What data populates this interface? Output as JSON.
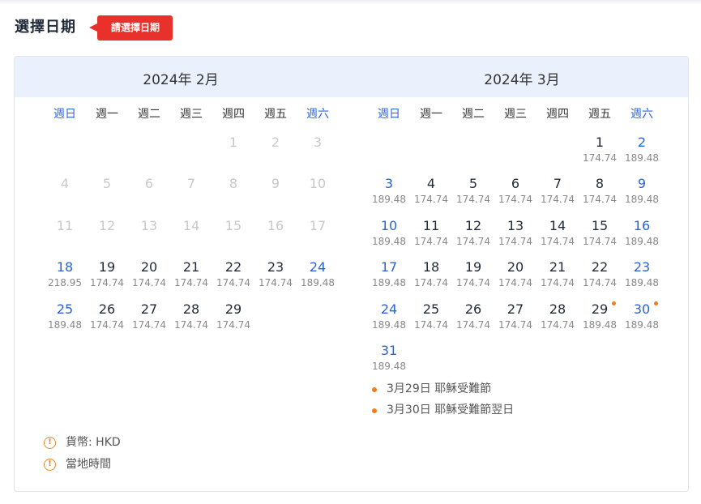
{
  "header": {
    "title": "選擇日期",
    "hint": "請選擇日期"
  },
  "weekdays": [
    "週日",
    "週一",
    "週二",
    "週三",
    "週四",
    "週五",
    "週六"
  ],
  "months": [
    {
      "title": "2024年 2月",
      "days": [
        {
          "d": "1",
          "p": "",
          "dis": true
        },
        {
          "d": "2",
          "p": "",
          "dis": true
        },
        {
          "d": "3",
          "p": "",
          "dis": true
        },
        {
          "d": "4",
          "p": "",
          "dis": true
        },
        {
          "d": "5",
          "p": "",
          "dis": true
        },
        {
          "d": "6",
          "p": "",
          "dis": true
        },
        {
          "d": "7",
          "p": "",
          "dis": true
        },
        {
          "d": "8",
          "p": "",
          "dis": true
        },
        {
          "d": "9",
          "p": "",
          "dis": true
        },
        {
          "d": "10",
          "p": "",
          "dis": true
        },
        {
          "d": "11",
          "p": "",
          "dis": true
        },
        {
          "d": "12",
          "p": "",
          "dis": true
        },
        {
          "d": "13",
          "p": "",
          "dis": true
        },
        {
          "d": "14",
          "p": "",
          "dis": true
        },
        {
          "d": "15",
          "p": "",
          "dis": true
        },
        {
          "d": "16",
          "p": "",
          "dis": true
        },
        {
          "d": "17",
          "p": "",
          "dis": true
        },
        {
          "d": "18",
          "p": "218.95"
        },
        {
          "d": "19",
          "p": "174.74"
        },
        {
          "d": "20",
          "p": "174.74"
        },
        {
          "d": "21",
          "p": "174.74"
        },
        {
          "d": "22",
          "p": "174.74"
        },
        {
          "d": "23",
          "p": "174.74"
        },
        {
          "d": "24",
          "p": "189.48"
        },
        {
          "d": "25",
          "p": "189.48"
        },
        {
          "d": "26",
          "p": "174.74"
        },
        {
          "d": "27",
          "p": "174.74"
        },
        {
          "d": "28",
          "p": "174.74"
        },
        {
          "d": "29",
          "p": "174.74"
        }
      ]
    },
    {
      "title": "2024年 3月",
      "days": [
        {
          "d": "1",
          "p": "174.74"
        },
        {
          "d": "2",
          "p": "189.48"
        },
        {
          "d": "3",
          "p": "189.48"
        },
        {
          "d": "4",
          "p": "174.74"
        },
        {
          "d": "5",
          "p": "174.74"
        },
        {
          "d": "6",
          "p": "174.74"
        },
        {
          "d": "7",
          "p": "174.74"
        },
        {
          "d": "8",
          "p": "174.74"
        },
        {
          "d": "9",
          "p": "189.48"
        },
        {
          "d": "10",
          "p": "189.48"
        },
        {
          "d": "11",
          "p": "174.74"
        },
        {
          "d": "12",
          "p": "174.74"
        },
        {
          "d": "13",
          "p": "174.74"
        },
        {
          "d": "14",
          "p": "174.74"
        },
        {
          "d": "15",
          "p": "174.74"
        },
        {
          "d": "16",
          "p": "189.48"
        },
        {
          "d": "17",
          "p": "189.48"
        },
        {
          "d": "18",
          "p": "174.74"
        },
        {
          "d": "19",
          "p": "174.74"
        },
        {
          "d": "20",
          "p": "174.74"
        },
        {
          "d": "21",
          "p": "174.74"
        },
        {
          "d": "22",
          "p": "174.74"
        },
        {
          "d": "23",
          "p": "189.48"
        },
        {
          "d": "24",
          "p": "189.48"
        },
        {
          "d": "25",
          "p": "174.74"
        },
        {
          "d": "26",
          "p": "174.74"
        },
        {
          "d": "27",
          "p": "174.74"
        },
        {
          "d": "28",
          "p": "174.74"
        },
        {
          "d": "29",
          "p": "189.48",
          "holiday": true
        },
        {
          "d": "30",
          "p": "189.48",
          "holiday": true
        },
        {
          "d": "31",
          "p": "189.48"
        }
      ],
      "holidays": [
        "3月29日 耶穌受難節",
        "3月30日 耶穌受難節翌日"
      ]
    }
  ],
  "notes": {
    "currency": "貨幣: HKD",
    "timezone": "當地時間"
  },
  "colors": {
    "accent": "#e8312a",
    "weekend": "#2a63d6",
    "holiday_dot": "#f07c1c",
    "header_bg": "#eaf1fc"
  }
}
